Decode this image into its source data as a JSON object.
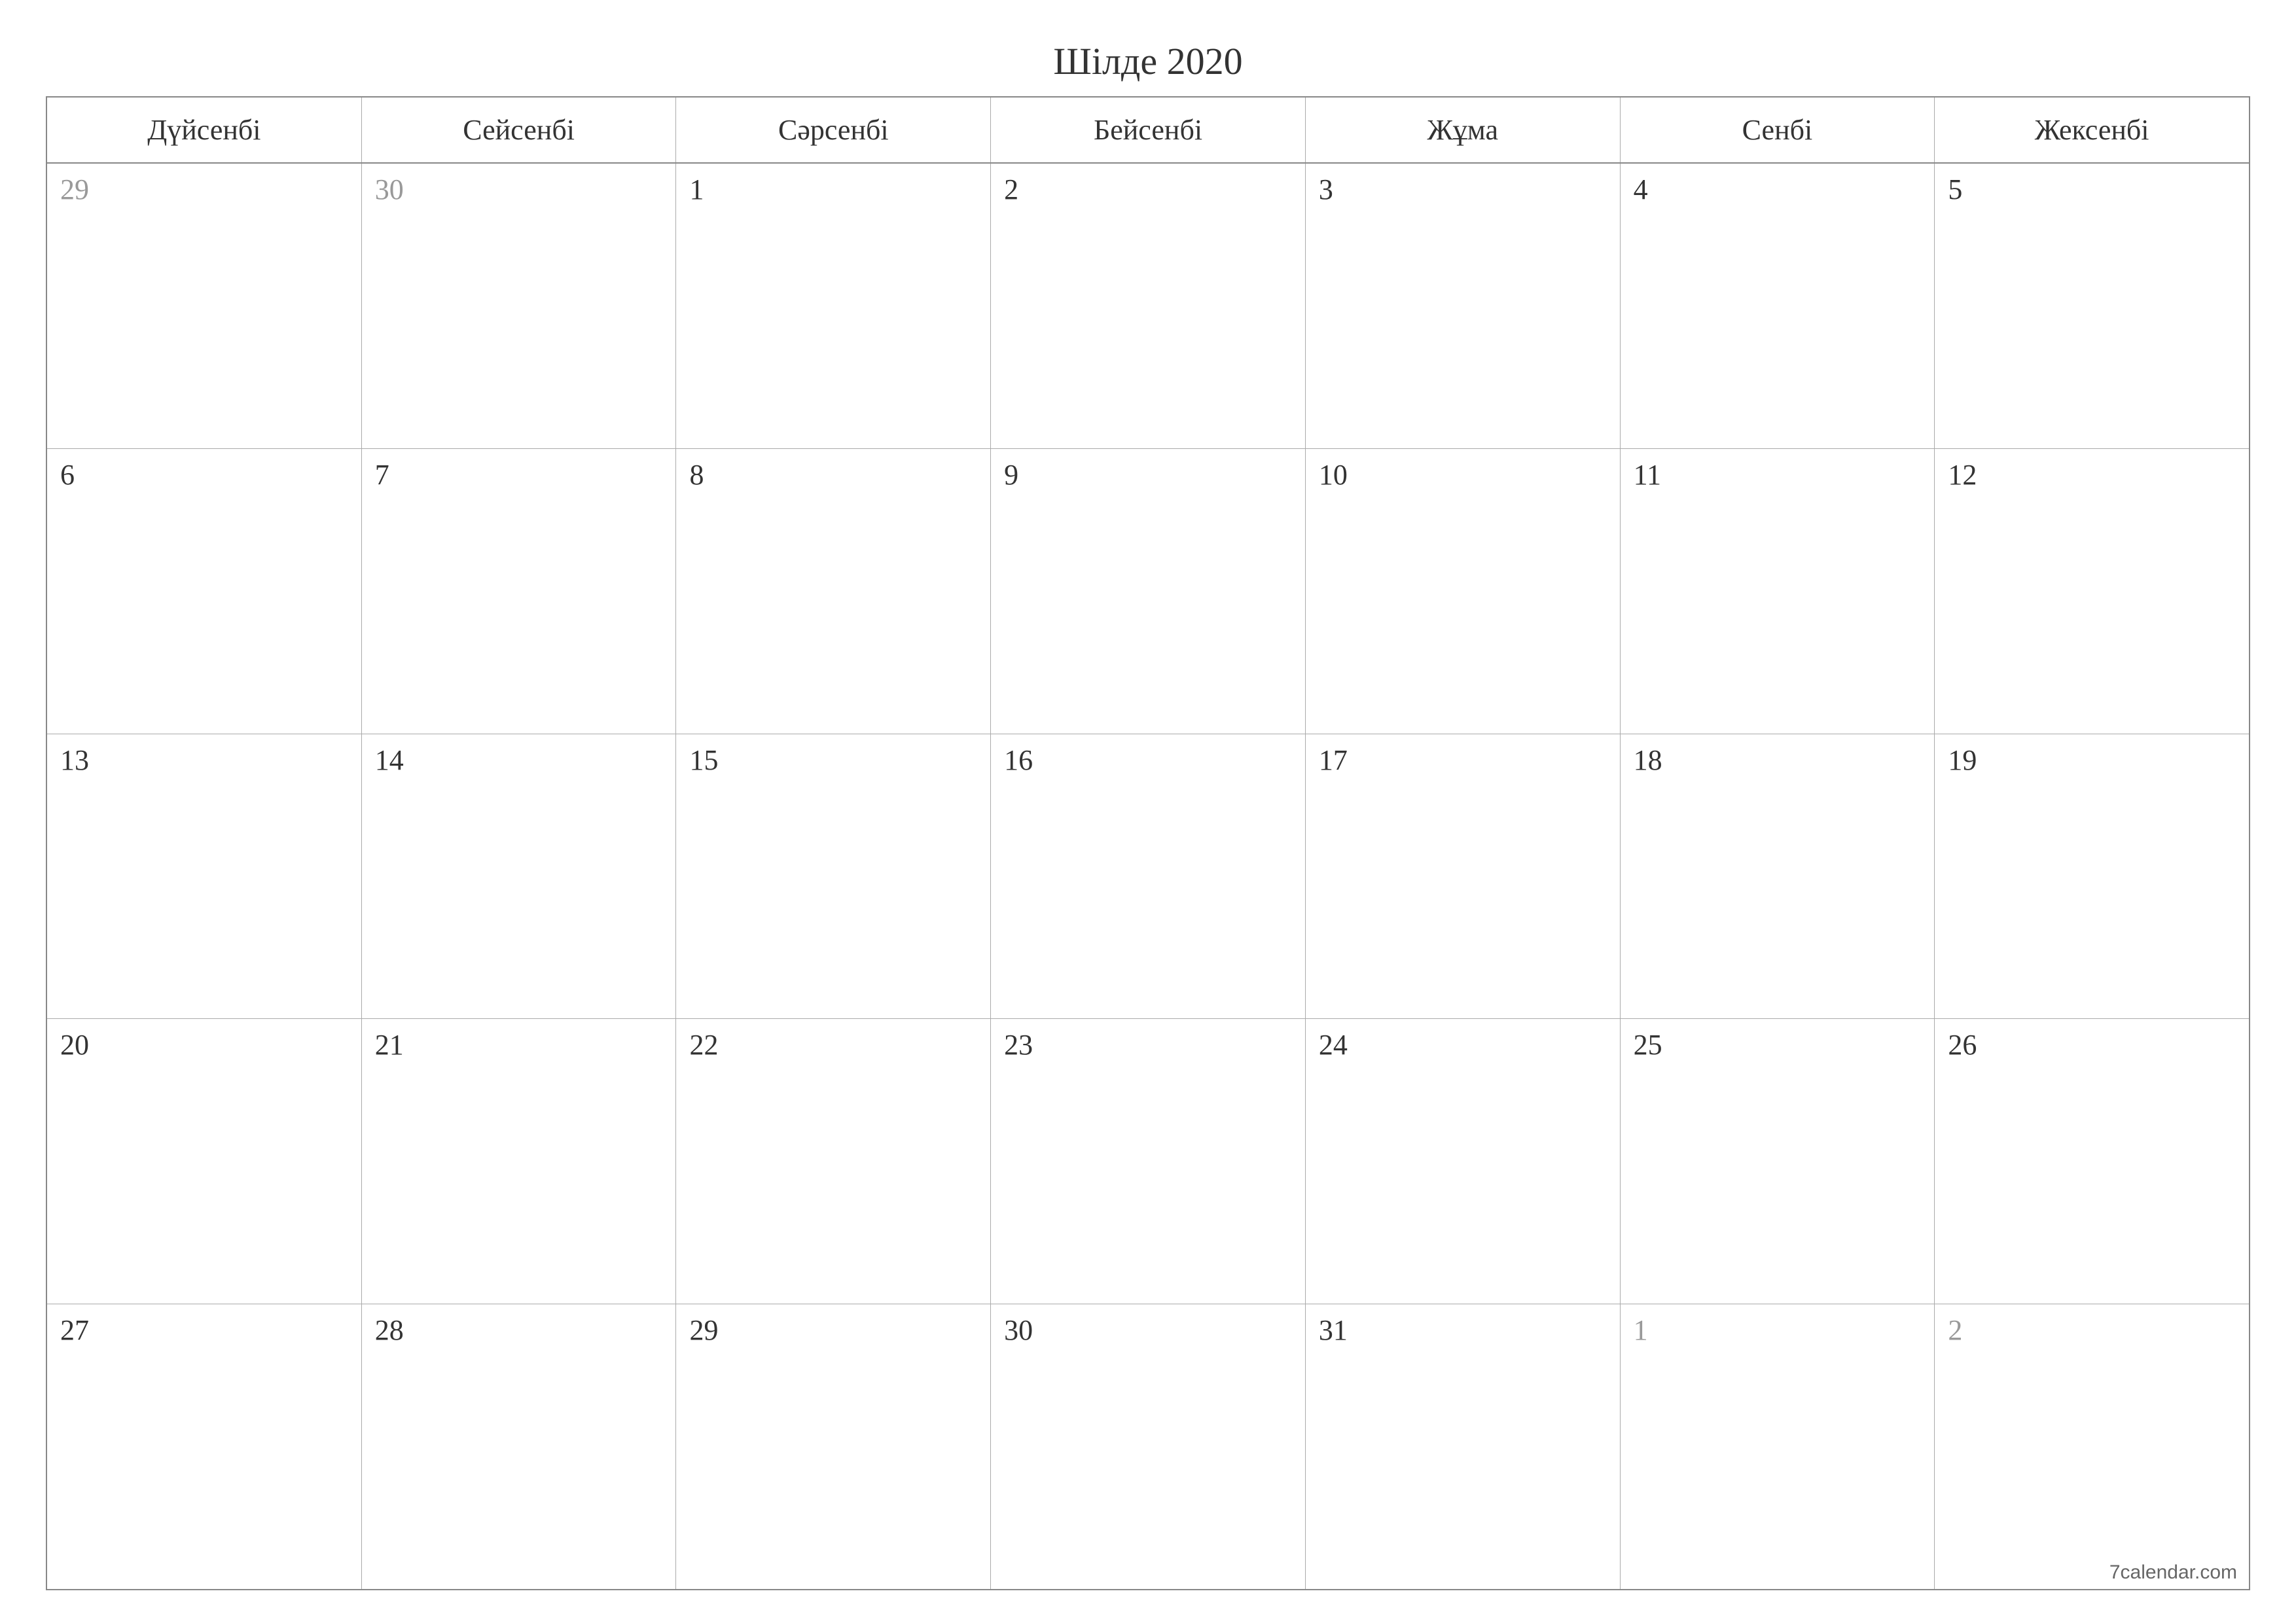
{
  "title": "Шілде 2020",
  "weekdays": [
    "Дүйсенбі",
    "Сейсенбі",
    "Сәрсенбі",
    "Бейсенбі",
    "Жұма",
    "Сенбі",
    "Жексенбі"
  ],
  "weeks": [
    [
      {
        "day": "29",
        "other": true
      },
      {
        "day": "30",
        "other": true
      },
      {
        "day": "1",
        "other": false
      },
      {
        "day": "2",
        "other": false
      },
      {
        "day": "3",
        "other": false
      },
      {
        "day": "4",
        "other": false
      },
      {
        "day": "5",
        "other": false
      }
    ],
    [
      {
        "day": "6",
        "other": false
      },
      {
        "day": "7",
        "other": false
      },
      {
        "day": "8",
        "other": false
      },
      {
        "day": "9",
        "other": false
      },
      {
        "day": "10",
        "other": false
      },
      {
        "day": "11",
        "other": false
      },
      {
        "day": "12",
        "other": false
      }
    ],
    [
      {
        "day": "13",
        "other": false
      },
      {
        "day": "14",
        "other": false
      },
      {
        "day": "15",
        "other": false
      },
      {
        "day": "16",
        "other": false
      },
      {
        "day": "17",
        "other": false
      },
      {
        "day": "18",
        "other": false
      },
      {
        "day": "19",
        "other": false
      }
    ],
    [
      {
        "day": "20",
        "other": false
      },
      {
        "day": "21",
        "other": false
      },
      {
        "day": "22",
        "other": false
      },
      {
        "day": "23",
        "other": false
      },
      {
        "day": "24",
        "other": false
      },
      {
        "day": "25",
        "other": false
      },
      {
        "day": "26",
        "other": false
      }
    ],
    [
      {
        "day": "27",
        "other": false
      },
      {
        "day": "28",
        "other": false
      },
      {
        "day": "29",
        "other": false
      },
      {
        "day": "30",
        "other": false
      },
      {
        "day": "31",
        "other": false
      },
      {
        "day": "1",
        "other": true
      },
      {
        "day": "2",
        "other": true
      }
    ]
  ],
  "footer": "7calendar.com"
}
